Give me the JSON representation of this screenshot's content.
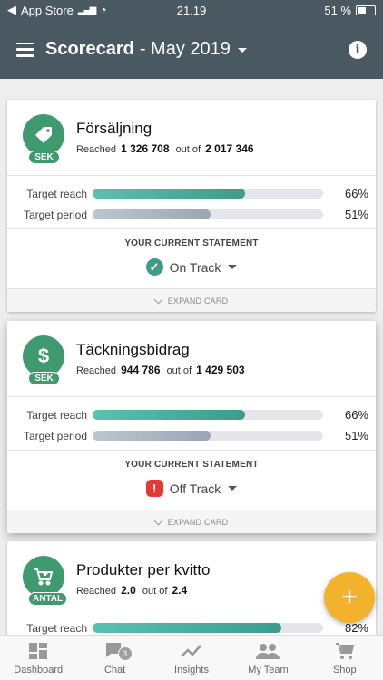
{
  "status_bar": {
    "carrier": "App Store",
    "time": "21.19",
    "battery": "51 %"
  },
  "header": {
    "title_bold": "Scorecard",
    "title_rest": "- May 2019"
  },
  "statement_title": "YOUR CURRENT STATEMENT",
  "expand_label": "EXPAND CARD",
  "reached_label": "Reached",
  "out_of_label": "out of",
  "cards": [
    {
      "title": "Försäljning",
      "unit_badge": "SEK",
      "icon": "tag-icon",
      "reached": "1 326 708",
      "target": "2 017 346",
      "metrics": [
        {
          "label": "Target reach",
          "value": "66%",
          "fraction": 0.66
        },
        {
          "label": "Target period",
          "value": "51%",
          "fraction": 0.51
        }
      ],
      "statement": "On Track",
      "statement_status": "on-track"
    },
    {
      "title": "Täckningsbidrag",
      "unit_badge": "SEK",
      "icon": "dollar-icon",
      "reached": "944 786",
      "target": "1 429 503",
      "metrics": [
        {
          "label": "Target reach",
          "value": "66%",
          "fraction": 0.66
        },
        {
          "label": "Target period",
          "value": "51%",
          "fraction": 0.51
        }
      ],
      "statement": "Off Track",
      "statement_status": "off-track"
    },
    {
      "title": "Produkter per kvitto",
      "unit_badge": "ANTAL",
      "icon": "cart-add-icon",
      "reached": "2.0",
      "target": "2.4",
      "metrics": [
        {
          "label": "Target reach",
          "value": "82%",
          "fraction": 0.82
        }
      ]
    }
  ],
  "bottom_nav": [
    {
      "label": "Dashboard",
      "icon": "dashboard-icon"
    },
    {
      "label": "Chat",
      "icon": "chat-icon",
      "badge": "3"
    },
    {
      "label": "Insights",
      "icon": "insights-icon"
    },
    {
      "label": "My Team",
      "icon": "team-icon"
    },
    {
      "label": "Shop",
      "icon": "cart-icon"
    }
  ],
  "colors": {
    "header_bg": "#4a5862",
    "badge_green": "#3f9a6f",
    "reach_bar": "#3d9c8a",
    "period_bar": "#9aa7b3",
    "on_track": "#3e9d86",
    "off_track": "#e53935",
    "fab": "#f3b22b"
  }
}
